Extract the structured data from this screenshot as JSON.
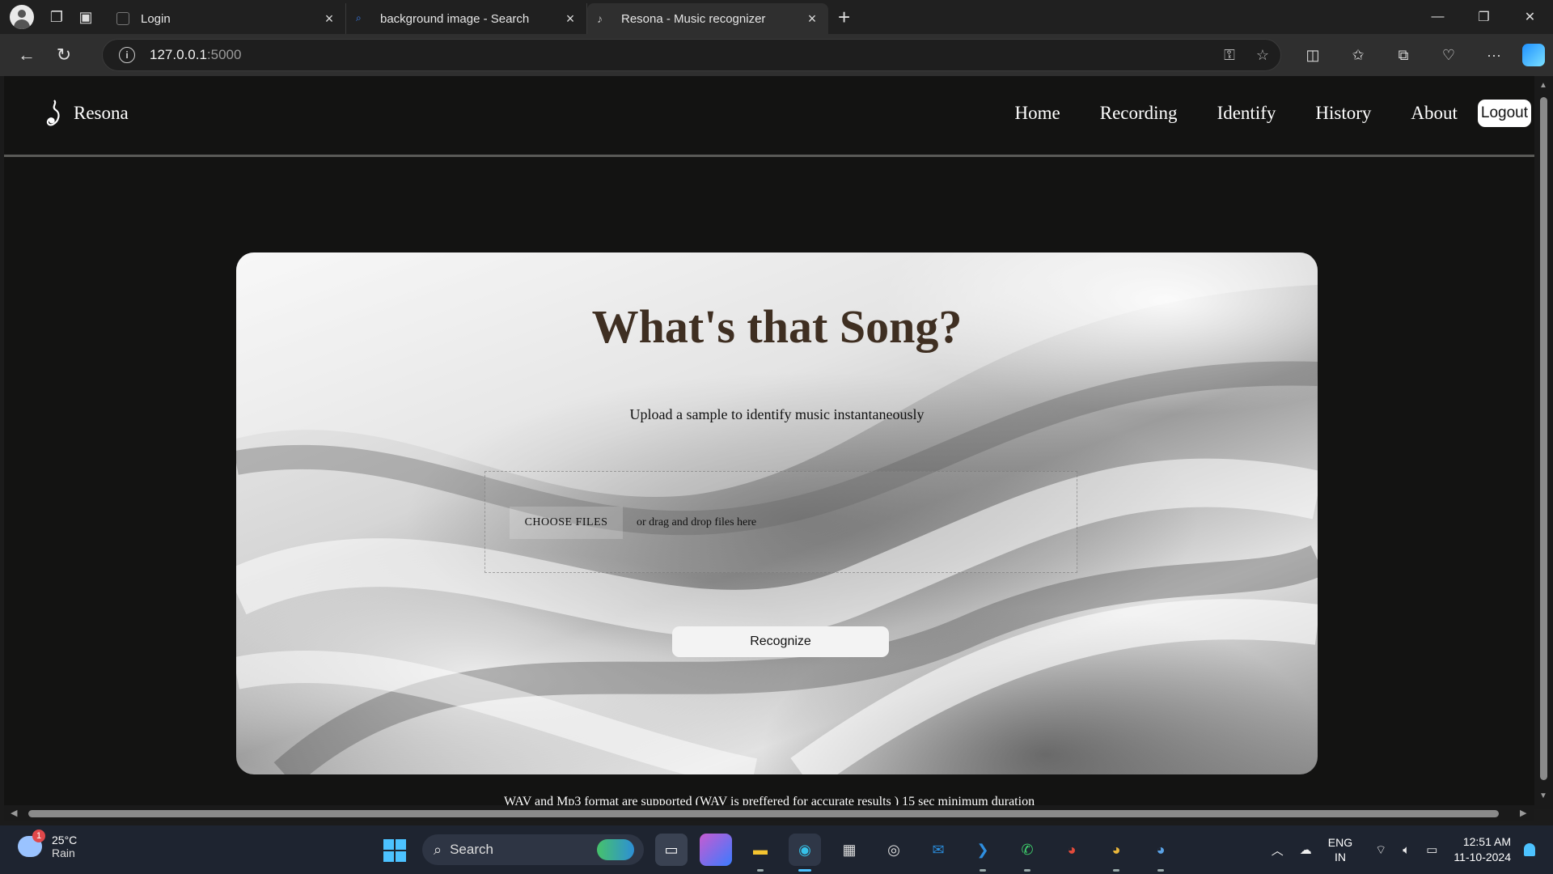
{
  "browser": {
    "tabs": [
      {
        "title": "Login",
        "icon": "page-icon"
      },
      {
        "title": "background image - Search",
        "icon": "search-icon"
      },
      {
        "title": "Resona - Music recognizer",
        "icon": "resona-icon",
        "active": true
      }
    ],
    "url_host": "127.0.0.1",
    "url_port": ":5000"
  },
  "site": {
    "brand": "Resona",
    "nav": [
      "Home",
      "Recording",
      "Identify",
      "History",
      "About"
    ],
    "logout": "Logout"
  },
  "main": {
    "title": "What's that Song?",
    "subtitle": "Upload a sample to identify music instantaneously",
    "choose_files": "CHOOSE FILES",
    "drop_text": "or drag and drop files here",
    "recognize": "Recognize",
    "footnote": "WAV and Mp3 format are supported (WAV is preffered for accurate results ) 15 sec minimum duration"
  },
  "taskbar": {
    "weather_temp": "25°C",
    "weather_desc": "Rain",
    "weather_badge": "1",
    "search": "Search",
    "lang_top": "ENG",
    "lang_bottom": "IN",
    "time": "12:51 AM",
    "date": "11-10-2024"
  },
  "colors": {
    "page_bg": "#131312",
    "title_color": "#3f2f22",
    "accent": "#4cc2ff"
  }
}
